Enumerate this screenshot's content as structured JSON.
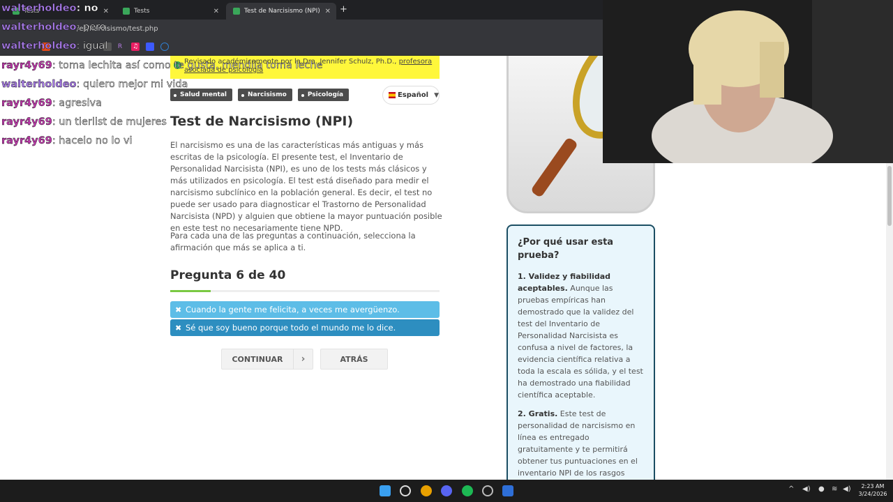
{
  "browser": {
    "tabs": [
      {
        "label": "Tests"
      },
      {
        "label": "Tests"
      },
      {
        "label": "Test de Narcisismo (NPI)"
      }
    ],
    "url": "/es/narcisismo/test.php"
  },
  "page": {
    "review_notice": "Revisado académicamente por la Dra. Jennifer Schulz, Ph.D.,",
    "review_link": "profesora asociada de psicología",
    "tags": [
      "Salud mental",
      "Narcisismo",
      "Psicología"
    ],
    "language": "Español",
    "title": "Test de Narcisismo (NPI)",
    "intro": "El narcisismo es una de las características más antiguas y más escritas de la psicología. El presente test, el Inventario de Personalidad Narcisista (NPI), es uno de los tests más clásicos y más utilizados en psicología. El test está diseñado para medir el narcisismo subclínico en la población general. Es decir, el test no puede ser usado para diagnosticar el Trastorno de Personalidad Narcisista (NPD) y alguien que obtiene la mayor puntuación posible en este test no necesariamente tiene NPD.",
    "instructions": "Para cada una de las preguntas a continuación, selecciona la afirmación que más se aplica a ti.",
    "question_label": "Pregunta 6 de 40",
    "progress_fraction": 0.15,
    "answers": [
      "Cuando la gente me felicita, a veces me avergüenzo.",
      "Sé que soy bueno porque todo el mundo me lo dice."
    ],
    "continue_label": "CONTINUAR",
    "back_label": "ATRÁS"
  },
  "sidebar": {
    "why_title": "¿Por qué usar esta prueba?",
    "point1_title": "1. Validez y fiabilidad aceptables.",
    "point1_text": " Aunque las pruebas empíricas han demostrado que la validez del test del Inventario de Personalidad Narcisista es confusa a nivel de factores, la evidencia científica relativa a toda la escala es sólida, y el test ha demostrado una fiabilidad científica aceptable.",
    "point2_title": "2. Gratis.",
    "point2_text": " Este test de personalidad de narcisismo en línea es entregado gratuitamente y te permitirá obtener tus puntuaciones en el inventario NPI de los rasgos narcisistas subclínicos."
  },
  "chat": [
    {
      "user": "walterholdeo",
      "msg": ": no"
    },
    {
      "user": "walterholdeo",
      "msg": ": pero"
    },
    {
      "user": "walterholdeo",
      "msg": ": igual"
    },
    {
      "user": "rayr4y69",
      "msg": ": toma lechita así como te gusta, mendiia toma leche"
    },
    {
      "user": "walterholdeo",
      "msg": ": quiero mejor mi vida"
    },
    {
      "user": "rayr4y69",
      "msg": ": agresiva"
    },
    {
      "user": "rayr4y69",
      "msg": ": un tierlist de mujeres"
    },
    {
      "user": "rayr4y69",
      "msg": ": hacelo no lo vi"
    }
  ],
  "taskbar": {
    "time": "2:23 AM",
    "date": "3/24/2026"
  }
}
